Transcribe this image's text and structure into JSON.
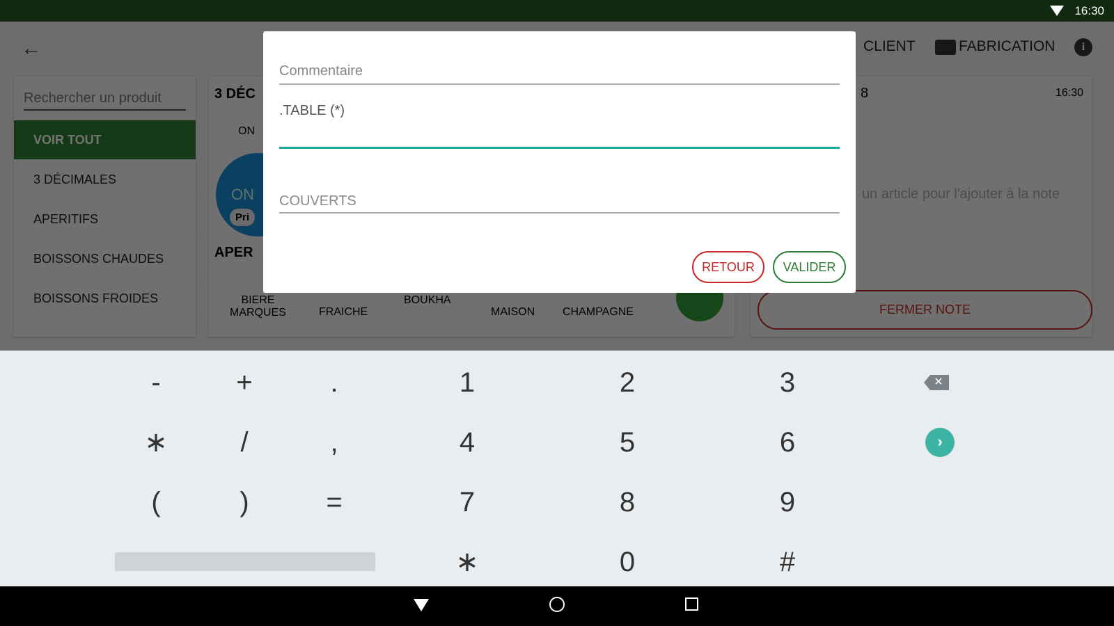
{
  "status_bar": {
    "time": "16:30"
  },
  "header": {
    "client_label": "CLIENT",
    "fabrication_label": "FABRICATION"
  },
  "sidebar": {
    "search_placeholder": "Rechercher un produit",
    "items": [
      {
        "label": "VOIR TOUT",
        "active": true
      },
      {
        "label": "3 DÉCIMALES"
      },
      {
        "label": "APERITIFS"
      },
      {
        "label": "BOISSONS CHAUDES"
      },
      {
        "label": "BOISSONS FROIDES"
      }
    ]
  },
  "main": {
    "section1": "3 DÉC",
    "tab_on": "ON",
    "circle_label": "ON",
    "price_chip": "Pri",
    "section2": "APER",
    "products": [
      "BIERE\nMARQUES",
      "FRAICHE",
      "BOUKHA",
      "MAISON",
      "CHAMPAGNE"
    ]
  },
  "note": {
    "number": "8",
    "time": "16:30",
    "empty_text": "un article pour l'ajouter à la note",
    "close_label": "FERMER NOTE"
  },
  "dialog": {
    "comment_placeholder": "Commentaire",
    "table_label": ".TABLE (*)",
    "table_value": "",
    "couverts_placeholder": "COUVERTS",
    "back_label": "RETOUR",
    "validate_label": "VALIDER"
  },
  "keyboard": {
    "rows": [
      [
        "-",
        "+",
        ".",
        "1",
        "2",
        "3"
      ],
      [
        "∗",
        "/",
        ",",
        "4",
        "5",
        "6"
      ],
      [
        "(",
        ")",
        "=",
        "7",
        "8",
        "9"
      ],
      [
        "∗",
        "0",
        "#"
      ]
    ]
  },
  "colors": {
    "accent_green": "#2e7d32",
    "teal": "#1aa99a",
    "red": "#c62828",
    "keyboard_bg": "#e9edf0"
  }
}
